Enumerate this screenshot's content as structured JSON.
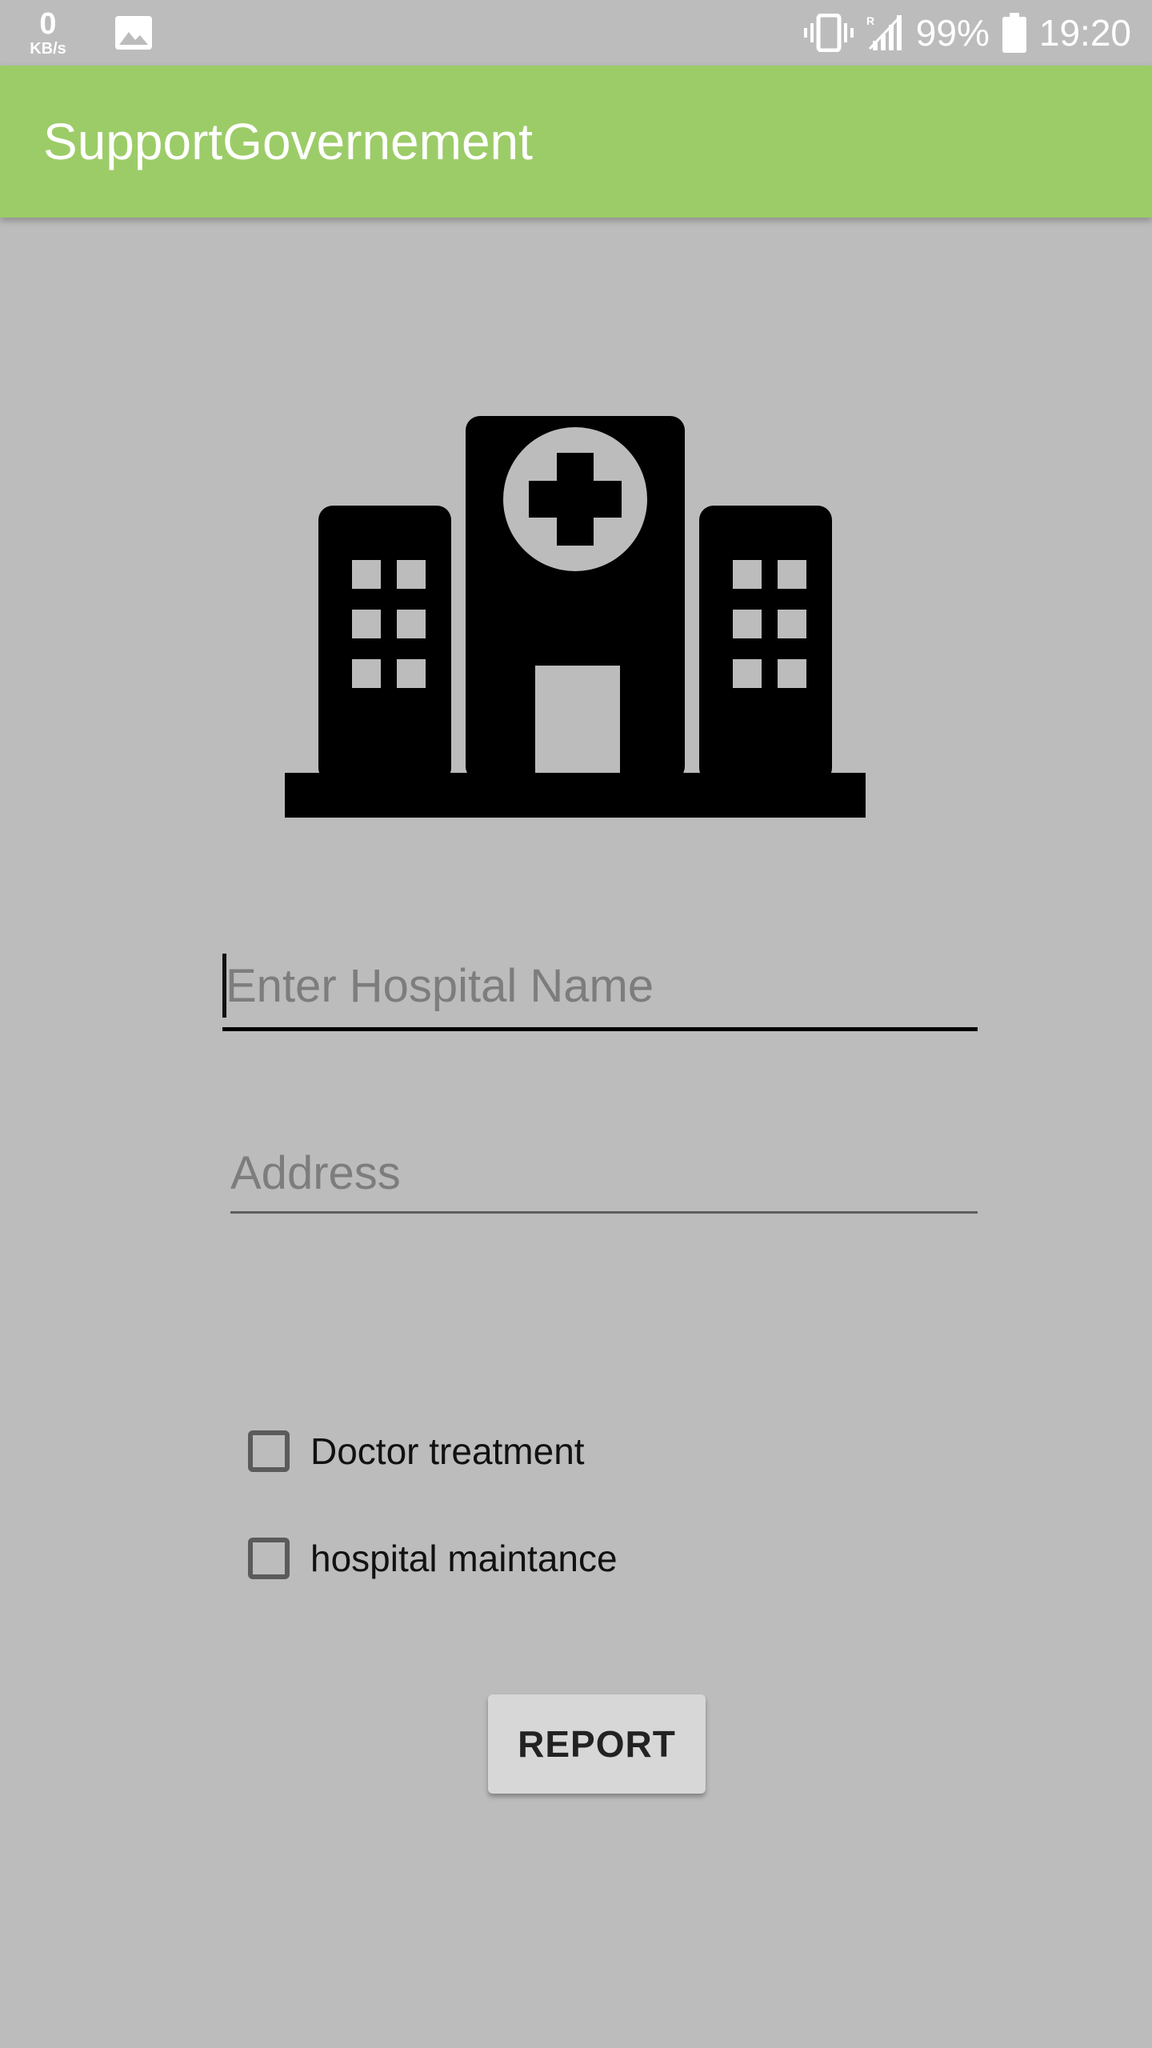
{
  "status_bar": {
    "net_speed_value": "0",
    "net_speed_unit": "KB/s",
    "battery_percent": "99%",
    "time": "19:20",
    "icons": [
      "image-icon",
      "vibrate-icon",
      "signal-icon",
      "battery-icon"
    ]
  },
  "app_bar": {
    "title": "SupportGovernement",
    "color": "#9ccc68"
  },
  "illustration": {
    "icon": "hospital-icon"
  },
  "form": {
    "hospital_name_placeholder": "Enter Hospital Name",
    "hospital_name_value": "",
    "address_placeholder": "Address",
    "address_value": ""
  },
  "checkboxes": [
    {
      "label": "Doctor treatment",
      "checked": false
    },
    {
      "label": "hospital maintance",
      "checked": false
    }
  ],
  "report_button": {
    "label": "REPORT"
  }
}
